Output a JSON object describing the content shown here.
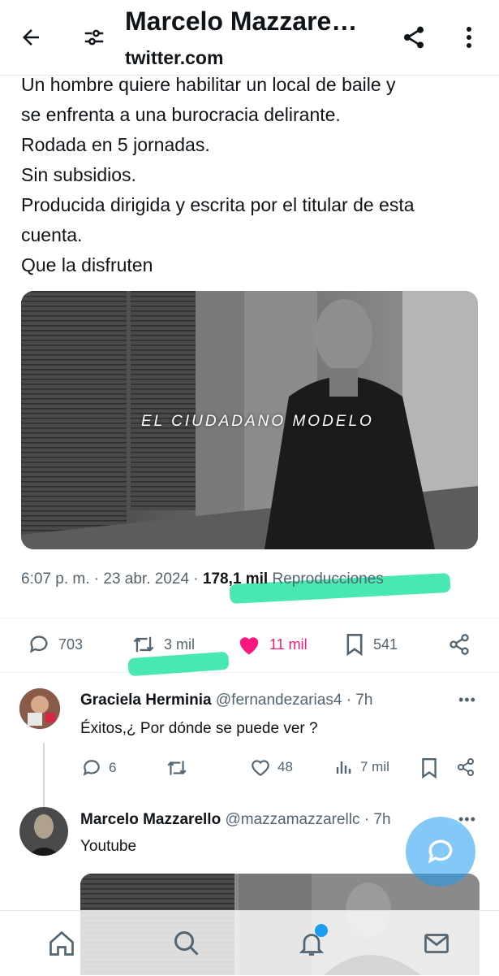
{
  "header": {
    "title": "Marcelo Mazzare…",
    "domain": "twitter.com",
    "back_icon": "arrow-left-icon",
    "settings_icon": "sliders-icon",
    "share_icon": "share-icon",
    "menu_icon": "more-vertical-icon"
  },
  "tweet": {
    "lines": [
      " Un hombre quiere habilitar un local de baile y",
      "se enfrenta a una burocracia delirante.",
      "Rodada en 5 jornadas.",
      "Sin subsidios.",
      "Producida dirigida y escrita por el titular de esta",
      "cuenta.",
      "Que la disfruten"
    ],
    "media_overlay": "EL CIUDADANO MODELO",
    "timestamp": "6:07 p. m. · 23 abr. 2024 · ",
    "views_count": "178,1 mil",
    "views_label": " Reproducciones",
    "stats": {
      "replies": "703",
      "retweets": "3 mil",
      "likes": "11 mil",
      "bookmarks": "541"
    },
    "like_color": "#f91880"
  },
  "replies": [
    {
      "name": "Graciela Herminia",
      "handle": " @fernandezarias4 · 7h",
      "text": "Éxitos,¿ Por dónde se puede ver ?",
      "replies": "6",
      "likes": "48",
      "views": "7 mil"
    },
    {
      "name": "Marcelo Mazzarello",
      "handle": " @mazzamazzarellc · 7h",
      "text": "Youtube"
    }
  ],
  "more_label": "•••",
  "nav": {
    "home": "home-icon",
    "search": "search-icon",
    "notifications": "bell-icon",
    "messages": "mail-icon"
  },
  "colors": {
    "highlight": "#35e6a8",
    "accent": "#1d9bf0"
  }
}
